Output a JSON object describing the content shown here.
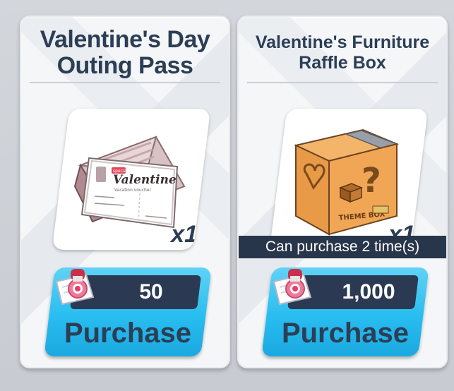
{
  "items": [
    {
      "title": "Valentine's Day Outing Pass",
      "quantity": "x1",
      "card_small_tag": "special",
      "card_heading": "Valentine",
      "card_sub": "Vacation voucher",
      "purchase_limit": "",
      "price": "50",
      "button_label": "Purchase"
    },
    {
      "title": "Valentine's Furniture Raffle Box",
      "quantity": "x1",
      "box_label": "THEME BOX",
      "purchase_limit": "Can purchase 2 time(s)",
      "price": "1,000",
      "button_label": "Purchase"
    }
  ],
  "currency_icon": "ticket-icon",
  "colors": {
    "button_blue": "#29bdf0",
    "price_bar": "#2b3a52",
    "title_text": "#2c3e55"
  }
}
